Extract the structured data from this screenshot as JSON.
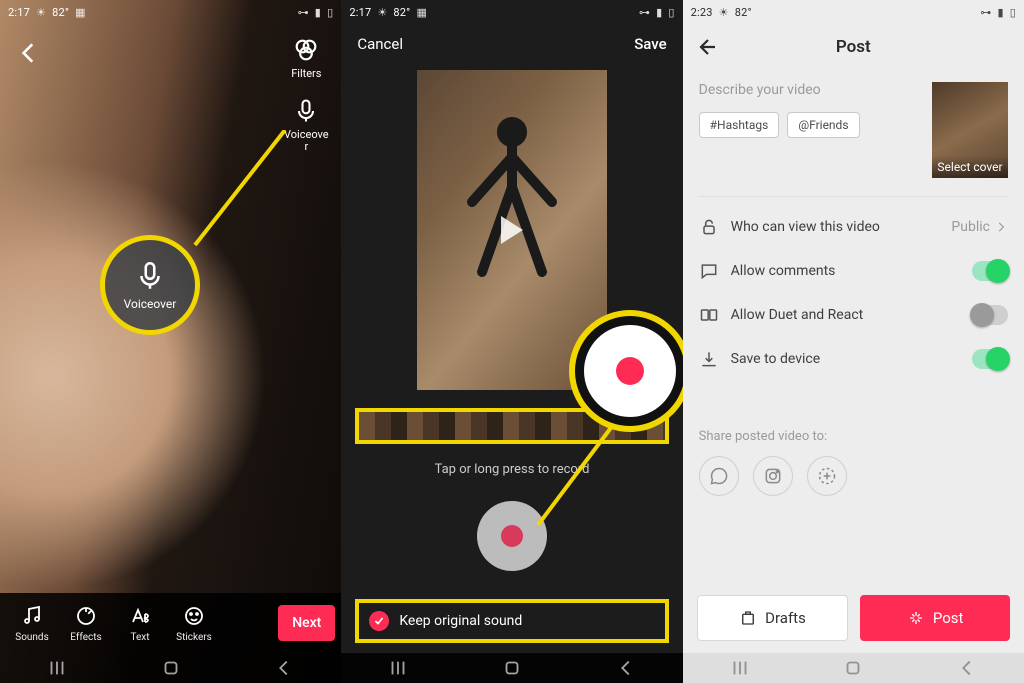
{
  "statusbar": {
    "time_a": "2:17",
    "time_b": "2:23",
    "temp": "82°"
  },
  "screen1": {
    "filters_label": "Filters",
    "voiceover_label": "Voiceover",
    "sounds": "Sounds",
    "effects": "Effects",
    "text": "Text",
    "stickers": "Stickers",
    "next": "Next",
    "callout_label": "Voiceover"
  },
  "screen2": {
    "cancel": "Cancel",
    "save": "Save",
    "hint": "Tap or long press to record",
    "keep_original": "Keep original sound"
  },
  "screen3": {
    "title": "Post",
    "describe_ph": "Describe your video",
    "hashtags": "#Hashtags",
    "friends": "@Friends",
    "select_cover": "Select cover",
    "who_view": "Who can view this video",
    "public": "Public",
    "allow_comments": "Allow comments",
    "allow_duet": "Allow Duet and React",
    "save_device": "Save to device",
    "share_label": "Share posted video to:",
    "drafts": "Drafts",
    "post": "Post"
  },
  "colors": {
    "accent": "#fe2c55",
    "highlight": "#f2d600",
    "toggle_on": "#25d366"
  }
}
